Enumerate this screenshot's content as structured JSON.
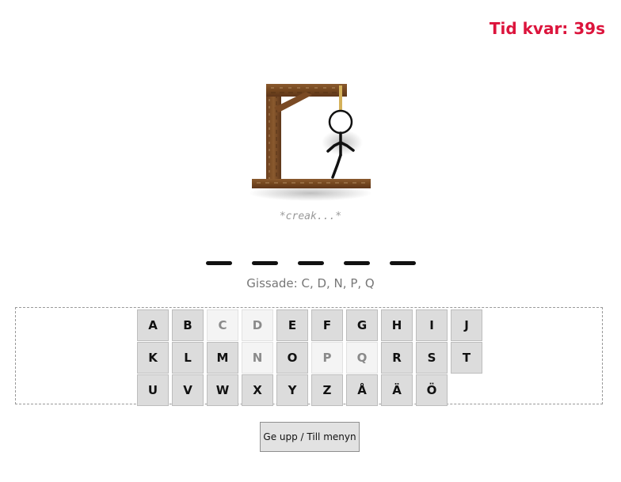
{
  "timer": {
    "label": "Tid kvar: 39s"
  },
  "status_sound": "*creak...*",
  "word": {
    "slots": [
      "",
      "",
      "",
      "",
      ""
    ]
  },
  "guessed_text": "Gissade: C, D, N, P, Q",
  "keyboard": {
    "rows": [
      [
        {
          "letter": "A",
          "used": false
        },
        {
          "letter": "B",
          "used": false
        },
        {
          "letter": "C",
          "used": true
        },
        {
          "letter": "D",
          "used": true
        },
        {
          "letter": "E",
          "used": false
        },
        {
          "letter": "F",
          "used": false
        },
        {
          "letter": "G",
          "used": false
        },
        {
          "letter": "H",
          "used": false
        },
        {
          "letter": "I",
          "used": false
        },
        {
          "letter": "J",
          "used": false
        }
      ],
      [
        {
          "letter": "K",
          "used": false
        },
        {
          "letter": "L",
          "used": false
        },
        {
          "letter": "M",
          "used": false
        },
        {
          "letter": "N",
          "used": true
        },
        {
          "letter": "O",
          "used": false
        },
        {
          "letter": "P",
          "used": true
        },
        {
          "letter": "Q",
          "used": true
        },
        {
          "letter": "R",
          "used": false
        },
        {
          "letter": "S",
          "used": false
        },
        {
          "letter": "T",
          "used": false
        }
      ],
      [
        {
          "letter": "U",
          "used": false
        },
        {
          "letter": "V",
          "used": false
        },
        {
          "letter": "W",
          "used": false
        },
        {
          "letter": "X",
          "used": false
        },
        {
          "letter": "Y",
          "used": false
        },
        {
          "letter": "Z",
          "used": false
        },
        {
          "letter": "Å",
          "used": false
        },
        {
          "letter": "Ä",
          "used": false
        },
        {
          "letter": "Ö",
          "used": false
        }
      ]
    ]
  },
  "buttons": {
    "give_up": "Ge upp / Till menyn"
  },
  "colors": {
    "timer": "#dc143c",
    "wood": "#7a4a24",
    "rope": "#d4b15a"
  },
  "icons": {
    "gallows": "gallows-with-hanged-stick-figure"
  }
}
